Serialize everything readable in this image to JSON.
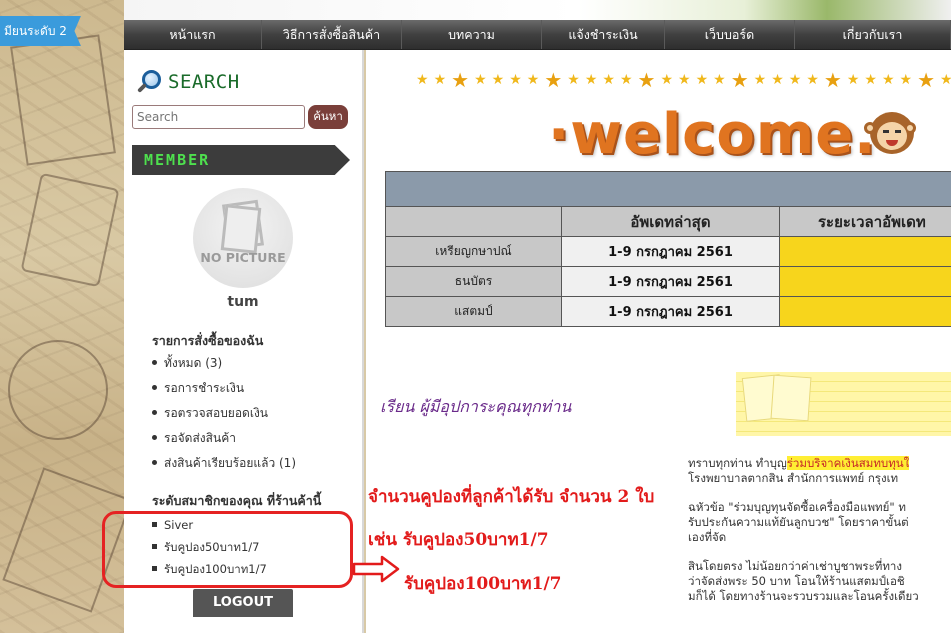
{
  "level_ribbon": "มียนระดับ 2",
  "nav": {
    "items": [
      {
        "label": "หน้าแรก",
        "w": 138
      },
      {
        "label": "วิธีการสั่งซื้อสินค้า",
        "w": 140
      },
      {
        "label": "บทความ",
        "w": 140
      },
      {
        "label": "แจ้งชำระเงิน",
        "w": 123
      },
      {
        "label": "เว็บบอร์ด",
        "w": 130
      },
      {
        "label": "เกี่ยวกับเรา",
        "w": 156
      }
    ]
  },
  "sidebar": {
    "search_title": "SEARCH",
    "search_placeholder": "Search",
    "search_button": "ค้นหา",
    "member_title": "MEMBER",
    "no_picture": "NO PICTURE",
    "username": "tum",
    "orders_title": "รายการสั่งซื้อของฉัน",
    "orders": [
      "ทั้งหมด (3)",
      "รอการชำระเงิน",
      "รอตรวจสอบยอดเงิน",
      "รอจัดส่งสินค้า",
      "ส่งสินค้าเรียบร้อยแล้ว (1)"
    ],
    "levels_title": "ระดับสมาชิกของคุณ ที่ร้านค้านี้",
    "levels": [
      "Siver",
      "รับคูปอง50บาท1/7",
      "รับคูปอง100บาท1/7"
    ],
    "logout": "LOGOUT"
  },
  "main": {
    "welcome": "·welcome.",
    "table": {
      "headers": [
        "",
        "อัพเดทล่าสุด",
        "ระยะเวลาอัพเดท"
      ],
      "rows": [
        {
          "category": "เหรียญกษาปณ์",
          "date": "1-9 กรกฎาคม 2561"
        },
        {
          "category": "ธนบัตร",
          "date": "1-9 กรกฎาคม 2561"
        },
        {
          "category": "แสตมป์",
          "date": "1-9 กรกฎาคม 2561"
        }
      ]
    },
    "greeting": "เรียน  ผู้มีอุปการะคุณทุกท่าน",
    "article": {
      "line1_before": "ทราบทุกท่าน   ทำบุญ",
      "line1_highlight": "ร่วมบริจาคเงินสมทบทุนใ",
      "line2": "โรงพยาบาลตากสิน  สำนักการแพทย์  กรุงเท",
      "line3": "ฉหัวข้อ  \"ร่วมบุญทุนจัดซื้อเครื่องมือแพทย์\"   ท",
      "line4": "รับประกันความแท้ยันลูกบวช\"   โดยราคาขั้นต่",
      "line5": "เองที่จัด",
      "line6": "สินโดยตรง   ไม่น้อยกว่าค่าเช่าบูชาพระที่ทาง",
      "line7": "ว่าจัดส่งพระ   50  บาท  โอนให้ร้านแสตมป์เอชิ",
      "line8": "มก็ได้  โดยทางร้านจะรวบรวมและโอนครั้งเดียว"
    }
  },
  "annotation": {
    "line1": "จำนวนคูปองที่ลูกค้าได้รับ จำนวน 2 ใบ",
    "line2": "เช่น รับคูปอง50บาท1/7",
    "line3": "รับคูปอง100บาท1/7"
  },
  "colors": {
    "nav_bg": "#404040",
    "member_text": "#4ee04e",
    "annotation_red": "#e21b1b",
    "welcome_orange": "#e07420",
    "table_period": "#f7d51c"
  }
}
